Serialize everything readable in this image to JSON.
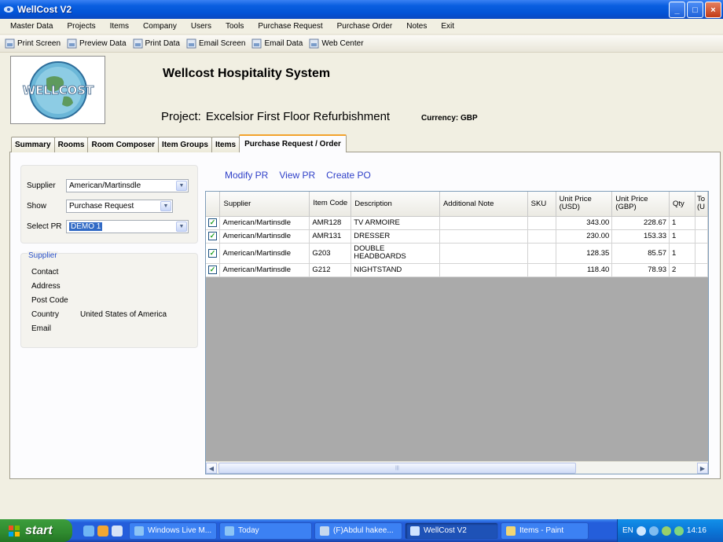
{
  "window": {
    "title": "WellCost V2",
    "buttons": [
      "_",
      "□",
      "×"
    ]
  },
  "menu": [
    "Master Data",
    "Projects",
    "Items",
    "Company",
    "Users",
    "Tools",
    "Purchase Request",
    "Purchase Order",
    "Notes",
    "Exit"
  ],
  "toolbar": [
    "Print Screen",
    "Preview Data",
    "Print Data",
    "Email Screen",
    "Email Data",
    "Web Center"
  ],
  "header": {
    "logo_text": "WELLCOST",
    "system_title": "Wellcost Hospitality System",
    "project_label": "Project:",
    "project_name": "Excelsior First Floor Refurbishment",
    "currency": "Currency: GBP"
  },
  "tabs": [
    "Summary",
    "Rooms",
    "Room Composer",
    "Item Groups",
    "Items",
    "Purchase Request / Order"
  ],
  "active_tab": "Purchase Request / Order",
  "filters": {
    "supplier_label": "Supplier",
    "supplier_value": "American/Martinsdle",
    "show_label": "Show",
    "show_value": "Purchase Request",
    "select_pr_label": "Select PR",
    "select_pr_value": "DEMO 1"
  },
  "supplier_panel": {
    "legend": "Supplier",
    "fields": [
      {
        "label": "Contact",
        "value": ""
      },
      {
        "label": "Address",
        "value": ""
      },
      {
        "label": "Post Code",
        "value": ""
      },
      {
        "label": "Country",
        "value": "United States of America"
      },
      {
        "label": "Email",
        "value": ""
      }
    ]
  },
  "actions": {
    "modify_pr": "Modify PR",
    "view_pr": "View PR",
    "create_po": "Create PO"
  },
  "grid": {
    "columns": [
      "",
      "Supplier",
      "Item Code",
      "Description",
      "Additional Note",
      "SKU",
      "Unit Price (USD)",
      "Unit Price (GBP)",
      "Qty",
      "To (U"
    ],
    "rows": [
      {
        "checked": true,
        "supplier": "American/Martinsdle",
        "code": "AMR128",
        "description": "TV ARMOIRE",
        "note": "",
        "sku": "",
        "usd": "343.00",
        "gbp": "228.67",
        "qty": "1"
      },
      {
        "checked": true,
        "supplier": "American/Martinsdle",
        "code": "AMR131",
        "description": "DRESSER",
        "note": "",
        "sku": "",
        "usd": "230.00",
        "gbp": "153.33",
        "qty": "1"
      },
      {
        "checked": true,
        "supplier": "American/Martinsdle",
        "code": "G203",
        "description": "DOUBLE HEADBOARDS",
        "note": "",
        "sku": "",
        "usd": "128.35",
        "gbp": "85.57",
        "qty": "1"
      },
      {
        "checked": true,
        "supplier": "American/Martinsdle",
        "code": "G212",
        "description": "NIGHTSTAND",
        "note": "",
        "sku": "",
        "usd": "118.40",
        "gbp": "78.93",
        "qty": "2"
      }
    ]
  },
  "taskbar": {
    "start": "start",
    "tasks": [
      "Windows Live M...",
      "Today",
      "(F)Abdul hakee...",
      "WellCost V2",
      "Items - Paint"
    ],
    "active_task": "WellCost V2",
    "lang": "EN",
    "clock": "14:16"
  },
  "colors": {
    "link": "#2e3fc8",
    "selection": "#316ac5",
    "tab_accent": "#f2a32d",
    "titlebar": "#0253d6"
  }
}
